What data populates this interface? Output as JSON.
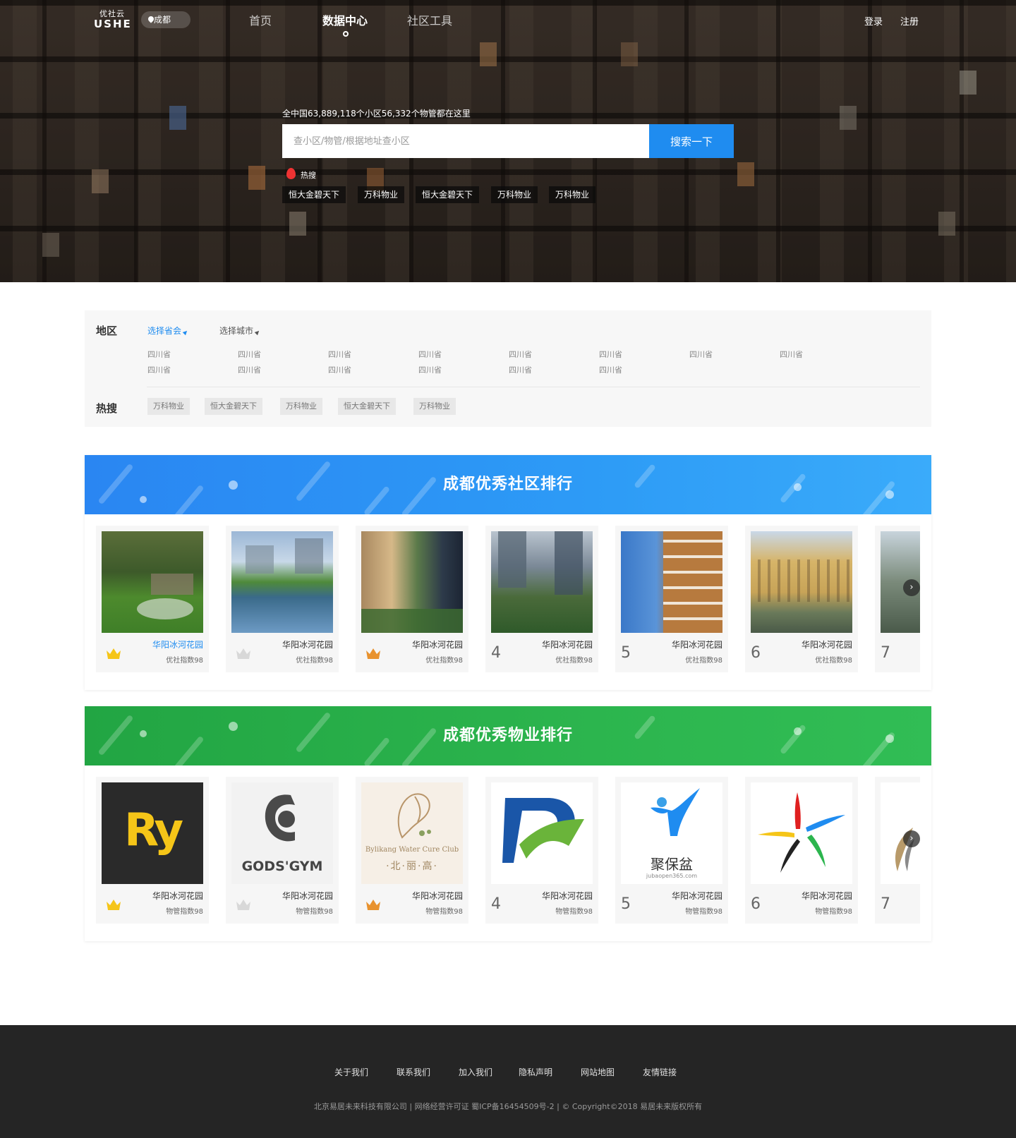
{
  "header": {
    "logo_cn": "优社云",
    "logo_en": "USHE",
    "city": "成都",
    "nav": [
      "首页",
      "数据中心",
      "社区工具"
    ],
    "login": "登录",
    "register": "注册"
  },
  "hero": {
    "slogan": "全中国63,889,118个小区56,332个物管都在这里",
    "search_placeholder": "查小区/物管/根据地址查小区",
    "search_button": "搜索一下",
    "hot_label": "热搜",
    "hot_tags": [
      "恒大金碧天下",
      "万科物业",
      "恒大金碧天下",
      "万科物业",
      "万科物业"
    ]
  },
  "filter": {
    "region_title": "地区",
    "province_select": "选择省会",
    "city_select": "选择城市",
    "provinces": [
      "四川省",
      "四川省",
      "四川省",
      "四川省",
      "四川省",
      "四川省",
      "四川省",
      "四川省",
      "四川省",
      "四川省",
      "四川省",
      "四川省",
      "四川省",
      "四川省"
    ],
    "hot_title": "热搜",
    "hot_chips": [
      "万科物业",
      "恒大金碧天下",
      "万科物业",
      "恒大金碧天下",
      "万科物业"
    ]
  },
  "community_ranking": {
    "title": "成都优秀社区排行",
    "items": [
      {
        "name": "华阳冰河花园",
        "score": "优社指数98",
        "rank": "1",
        "crown": "gold"
      },
      {
        "name": "华阳冰河花园",
        "score": "优社指数98",
        "rank": "2",
        "crown": "silver"
      },
      {
        "name": "华阳冰河花园",
        "score": "优社指数98",
        "rank": "3",
        "crown": "bronze"
      },
      {
        "name": "华阳冰河花园",
        "score": "优社指数98",
        "rank": "4"
      },
      {
        "name": "华阳冰河花园",
        "score": "优社指数98",
        "rank": "5"
      },
      {
        "name": "华阳冰河花园",
        "score": "优社指数98",
        "rank": "6"
      },
      {
        "name": "",
        "score": "",
        "rank": "7"
      }
    ]
  },
  "property_ranking": {
    "title": "成都优秀物业排行",
    "items": [
      {
        "name": "华阳冰河花园",
        "score": "物管指数98",
        "rank": "1",
        "crown": "gold",
        "logo_text": "Ry"
      },
      {
        "name": "华阳冰河花园",
        "score": "物管指数98",
        "rank": "2",
        "crown": "silver",
        "logo_text": "GODS'GYM"
      },
      {
        "name": "华阳冰河花园",
        "score": "物管指数98",
        "rank": "3",
        "crown": "bronze",
        "logo_text": "Bylikang Water Cure Club",
        "logo_text2": "·北·丽·高·"
      },
      {
        "name": "华阳冰河花园",
        "score": "物管指数98",
        "rank": "4"
      },
      {
        "name": "华阳冰河花园",
        "score": "物管指数98",
        "rank": "5",
        "logo_text": "聚保盆",
        "logo_text2": "jubaopen365.com"
      },
      {
        "name": "华阳冰河花园",
        "score": "物管指数98",
        "rank": "6"
      },
      {
        "name": "",
        "score": "",
        "rank": "7"
      }
    ]
  },
  "footer": {
    "links": [
      "关于我们",
      "联系我们",
      "加入我们",
      "隐私声明",
      "网站地图",
      "友情链接"
    ],
    "copyright": "北京易居未来科技有限公司 | 网络经营许可证 蜀ICP备16454509号-2 | © Copyright©2018 易居未来版权所有"
  },
  "colors": {
    "accent_blue": "#1f8cf0",
    "green_banner": "#2cb54e",
    "footer_bg": "#252525",
    "crown_gold": "#f5c518",
    "crown_silver": "#d8d8d8",
    "crown_bronze": "#e8922e"
  },
  "icons": [
    "location-pin-icon",
    "fire-icon",
    "crown-icon",
    "chevron-right-icon"
  ]
}
